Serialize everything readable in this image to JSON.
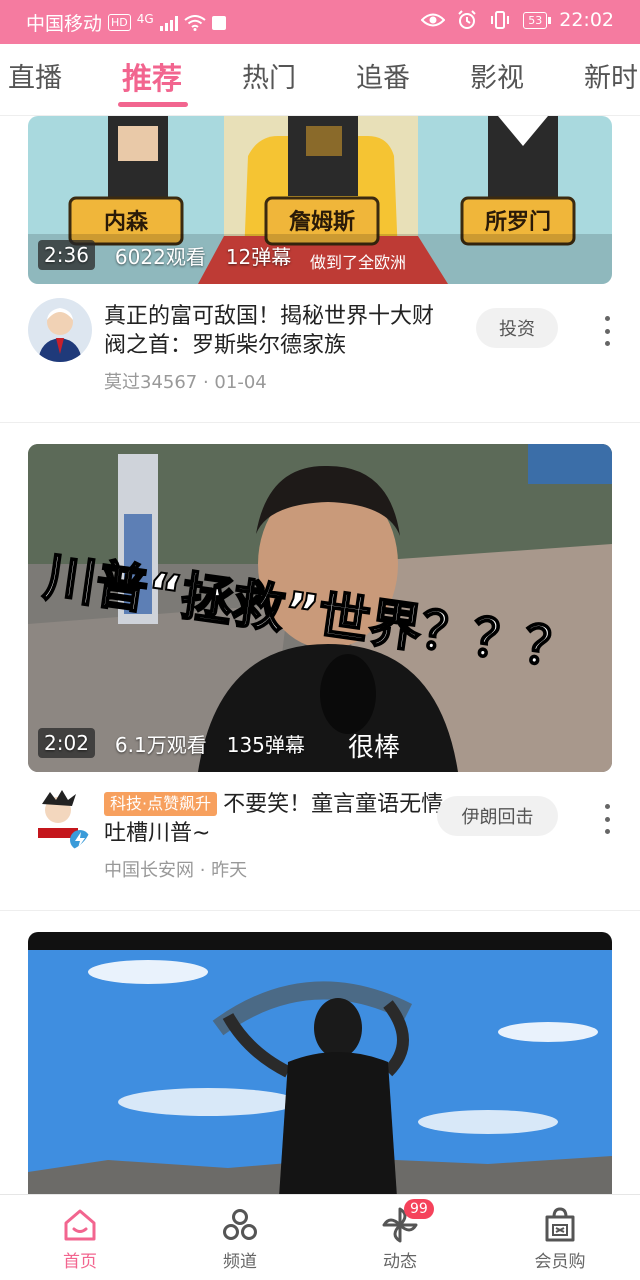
{
  "status_bar": {
    "carrier": "中国移动",
    "hd": "HD",
    "network": "4G",
    "battery": "53",
    "time": "22:02"
  },
  "tabs": [
    {
      "label": "直播"
    },
    {
      "label": "推荐",
      "active": true
    },
    {
      "label": "热门"
    },
    {
      "label": "追番"
    },
    {
      "label": "影视"
    },
    {
      "label": "新时"
    }
  ],
  "feed": [
    {
      "duration": "2:36",
      "views": "6022观看",
      "danmaku": "12弹幕",
      "thumb_labels": [
        "内森",
        "詹姆斯",
        "所罗门"
      ],
      "thumb_caption": "做到了全欧洲",
      "title": "真正的富可敌国！揭秘世界十大财阀之首：罗斯柴尔德家族",
      "meta": "莫过34567 · 01-04",
      "tag": "投资"
    },
    {
      "duration": "2:02",
      "views": "6.1万观看",
      "danmaku": "135弹幕",
      "thumb_caption": "川普“拯救”世界？？？",
      "thumb_subcaption": "很棒",
      "badge": "科技·点赞飙升",
      "title": "不要笑！童言童语无情吐槽川普~",
      "meta": "中国长安网 · 昨天",
      "tag": "伊朗回击"
    }
  ],
  "bottom_nav": [
    {
      "label": "首页",
      "icon": "home-icon",
      "active": true
    },
    {
      "label": "频道",
      "icon": "channel-icon"
    },
    {
      "label": "动态",
      "icon": "pinwheel-icon",
      "badge": "99"
    },
    {
      "label": "会员购",
      "icon": "shopping-bag-icon"
    }
  ],
  "colors": {
    "accent": "#f2658f",
    "status_bar": "#f57ba0",
    "badge": "#f7a05e"
  }
}
